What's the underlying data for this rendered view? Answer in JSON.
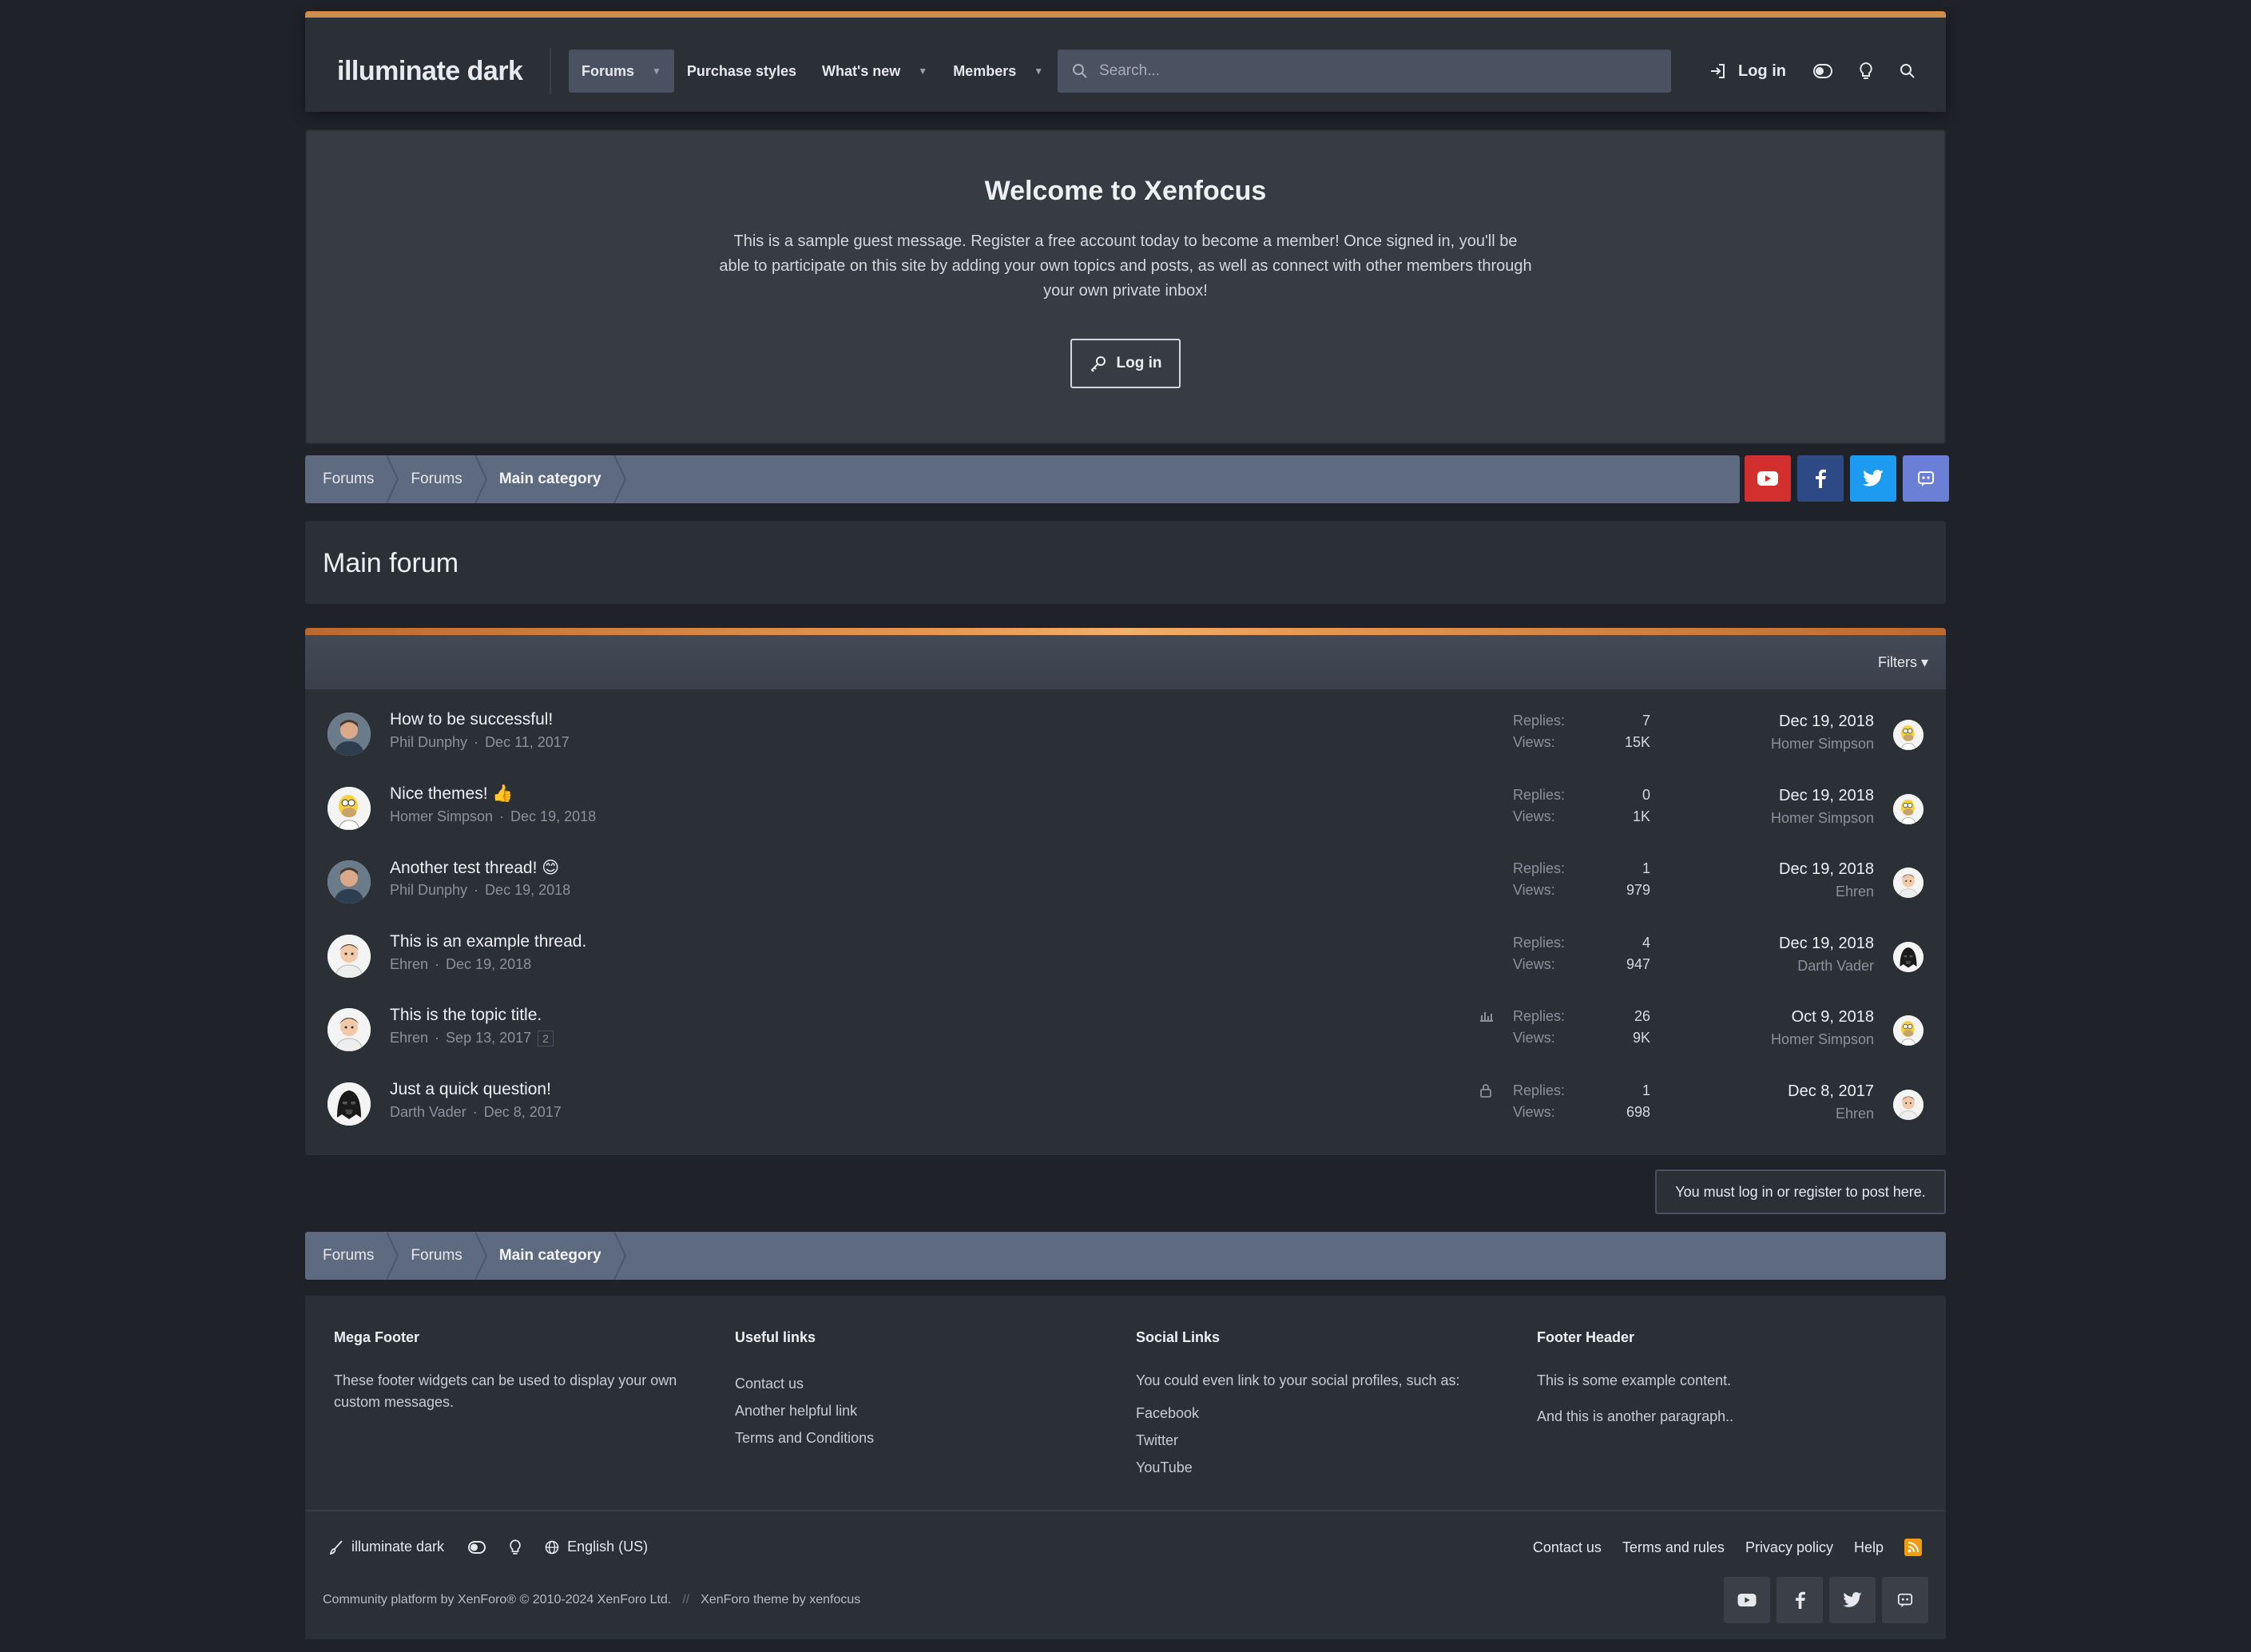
{
  "header": {
    "logo": "illuminate dark",
    "nav": [
      {
        "label": "Forums",
        "active": true,
        "dropdown": true
      },
      {
        "label": "Purchase styles",
        "active": false,
        "dropdown": false
      },
      {
        "label": "What's new",
        "active": false,
        "dropdown": true
      },
      {
        "label": "Members",
        "active": false,
        "dropdown": true
      }
    ],
    "search_placeholder": "Search...",
    "login_label": "Log in"
  },
  "notice": {
    "title": "Welcome to Xenfocus",
    "message": "This is a sample guest message. Register a free account today to become a member! Once signed in, you'll be able to participate on this site by adding your own topics and posts, as well as connect with other members through your own private inbox!",
    "button": "Log in"
  },
  "breadcrumb": [
    "Forums",
    "Forums",
    "Main category"
  ],
  "social_colors": {
    "youtube": "#d32f2f",
    "facebook": "#2d4a86",
    "twitter": "#1d9bf0",
    "discord": "#6b7fd7"
  },
  "page_title": "Main forum",
  "filters_label": "Filters",
  "threads": [
    {
      "title": "How to be successful!",
      "author": "Phil Dunphy",
      "date": "Dec 11, 2017",
      "pages": "",
      "status_icon": "",
      "replies_label": "Replies:",
      "replies": "7",
      "views_label": "Views:",
      "views": "15K",
      "last_date": "Dec 19, 2018",
      "last_user": "Homer Simpson",
      "avatar": "phil",
      "last_avatar": "homer"
    },
    {
      "title": "Nice themes! 👍",
      "author": "Homer Simpson",
      "date": "Dec 19, 2018",
      "pages": "",
      "status_icon": "",
      "replies_label": "Replies:",
      "replies": "0",
      "views_label": "Views:",
      "views": "1K",
      "last_date": "Dec 19, 2018",
      "last_user": "Homer Simpson",
      "avatar": "homer",
      "last_avatar": "homer"
    },
    {
      "title": "Another test thread! 😊",
      "author": "Phil Dunphy",
      "date": "Dec 19, 2018",
      "pages": "",
      "status_icon": "",
      "replies_label": "Replies:",
      "replies": "1",
      "views_label": "Views:",
      "views": "979",
      "last_date": "Dec 19, 2018",
      "last_user": "Ehren",
      "avatar": "phil",
      "last_avatar": "ehren"
    },
    {
      "title": "This is an example thread.",
      "author": "Ehren",
      "date": "Dec 19, 2018",
      "pages": "",
      "status_icon": "",
      "replies_label": "Replies:",
      "replies": "4",
      "views_label": "Views:",
      "views": "947",
      "last_date": "Dec 19, 2018",
      "last_user": "Darth Vader",
      "avatar": "ehren",
      "last_avatar": "vader"
    },
    {
      "title": "This is the topic title.",
      "author": "Ehren",
      "date": "Sep 13, 2017",
      "pages": "2",
      "status_icon": "poll-icon",
      "replies_label": "Replies:",
      "replies": "26",
      "views_label": "Views:",
      "views": "9K",
      "last_date": "Oct 9, 2018",
      "last_user": "Homer Simpson",
      "avatar": "ehren",
      "last_avatar": "homer"
    },
    {
      "title": "Just a quick question!",
      "author": "Darth Vader",
      "date": "Dec 8, 2017",
      "pages": "",
      "status_icon": "lock-icon",
      "replies_label": "Replies:",
      "replies": "1",
      "views_label": "Views:",
      "views": "698",
      "last_date": "Dec 8, 2017",
      "last_user": "Ehren",
      "avatar": "vader",
      "last_avatar": "ehren"
    }
  ],
  "must_login": "You must log in or register to post here.",
  "footer": {
    "cols": [
      {
        "title": "Mega Footer",
        "text": "These footer widgets can be used to display your own custom messages.",
        "links": []
      },
      {
        "title": "Useful links",
        "text": "",
        "links": [
          "Contact us",
          "Another helpful link",
          "Terms and Conditions"
        ]
      },
      {
        "title": "Social Links",
        "text": "You could even link to your social profiles, such as:",
        "links": [
          "Facebook",
          "Twitter",
          "YouTube"
        ]
      },
      {
        "title": "Footer Header",
        "text": "This is some example content.",
        "text2": "And this is another paragraph..",
        "links": []
      }
    ],
    "style_label": "illuminate dark",
    "language": "English (US)",
    "right_links": [
      "Contact us",
      "Terms and rules",
      "Privacy policy",
      "Help"
    ],
    "copyright": "Community platform by XenForo® © 2010-2024 XenForo Ltd.",
    "copyright_sep": "//",
    "theme_credit": "XenForo theme by xenfocus"
  }
}
